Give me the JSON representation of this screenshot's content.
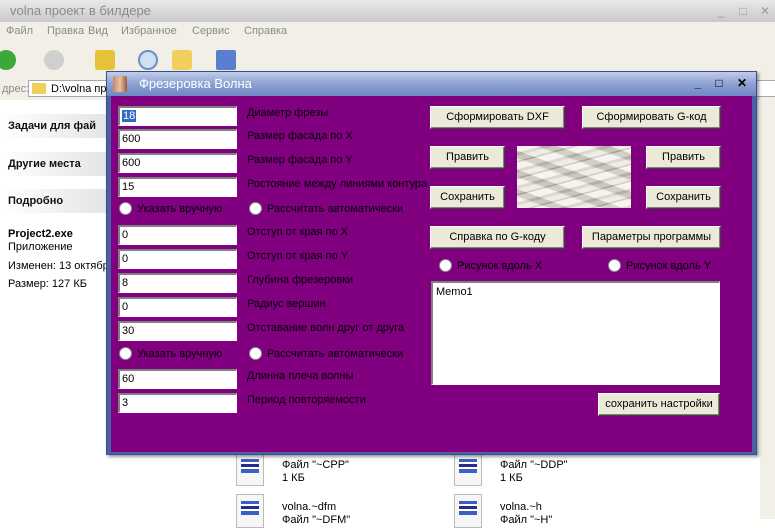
{
  "background": {
    "window_title": "volna проект в билдере",
    "menu": [
      "Файл",
      "Правка",
      "Вид",
      "Избранное",
      "Сервис",
      "Справка"
    ],
    "address_label": "дрес:",
    "address_value": "D:\\volna пр",
    "sections": {
      "tasks": "Задачи для фай",
      "other_places": "Другие места",
      "details": "Подробно"
    },
    "details": {
      "name": "Project2.exe",
      "type": "Приложение",
      "modified": "Изменен: 13 октябр",
      "size": "Размер: 127 КБ"
    },
    "files": [
      {
        "name": "",
        "type": "Файл \"~CPP\"",
        "size": "1 КБ"
      },
      {
        "name": "",
        "type": "Файл \"~DDP\"",
        "size": "1 КБ"
      },
      {
        "name": "volna.~dfm",
        "type": "Файл \"~DFM\"",
        "size": ""
      },
      {
        "name": "volna.~h",
        "type": "Файл \"~H\"",
        "size": ""
      }
    ]
  },
  "dialog": {
    "title": "Фрезеровка Волна",
    "fields": [
      {
        "value": "18",
        "label": "Диаметр фрезы"
      },
      {
        "value": "600",
        "label": "Размер фасада по X"
      },
      {
        "value": "600",
        "label": "Размер фасада по Y"
      },
      {
        "value": "15",
        "label": "Ростояние между линиями контура"
      },
      {
        "value": "0",
        "label": "Отступ от края по X"
      },
      {
        "value": "0",
        "label": "Отступ от края по Y"
      },
      {
        "value": "8",
        "label": "Глубина фрезеровки"
      },
      {
        "value": "0",
        "label": "Радиус вершин"
      },
      {
        "value": "30",
        "label": "Отставание волн друг от друга"
      },
      {
        "value": "60",
        "label": "Длинна плеча волны"
      },
      {
        "value": "3",
        "label": "Период повторяемости"
      }
    ],
    "radios1": {
      "manual": "Указать вручную",
      "auto": "Рассчитать автоматически"
    },
    "radios2": {
      "manual": "Указать вручную",
      "auto": "Рассчитать автоматически"
    },
    "buttons": {
      "dxf": "Сформировать DXF",
      "gcode": "Сформировать G-код",
      "edit_left": "Править",
      "save_left": "Сохранить",
      "edit_right": "Править",
      "save_right": "Сохранить",
      "help_gcode": "Справка по G-коду",
      "params": "Параметры программы",
      "save_settings": "сохранить настройки"
    },
    "pattern_radios": {
      "along_x": "Рисунок вдоль X",
      "along_y": "Рисунок вдоль Y"
    },
    "memo": "Memo1",
    "colors": {
      "client": "#800080",
      "titlebar": "#6f86c4"
    }
  }
}
